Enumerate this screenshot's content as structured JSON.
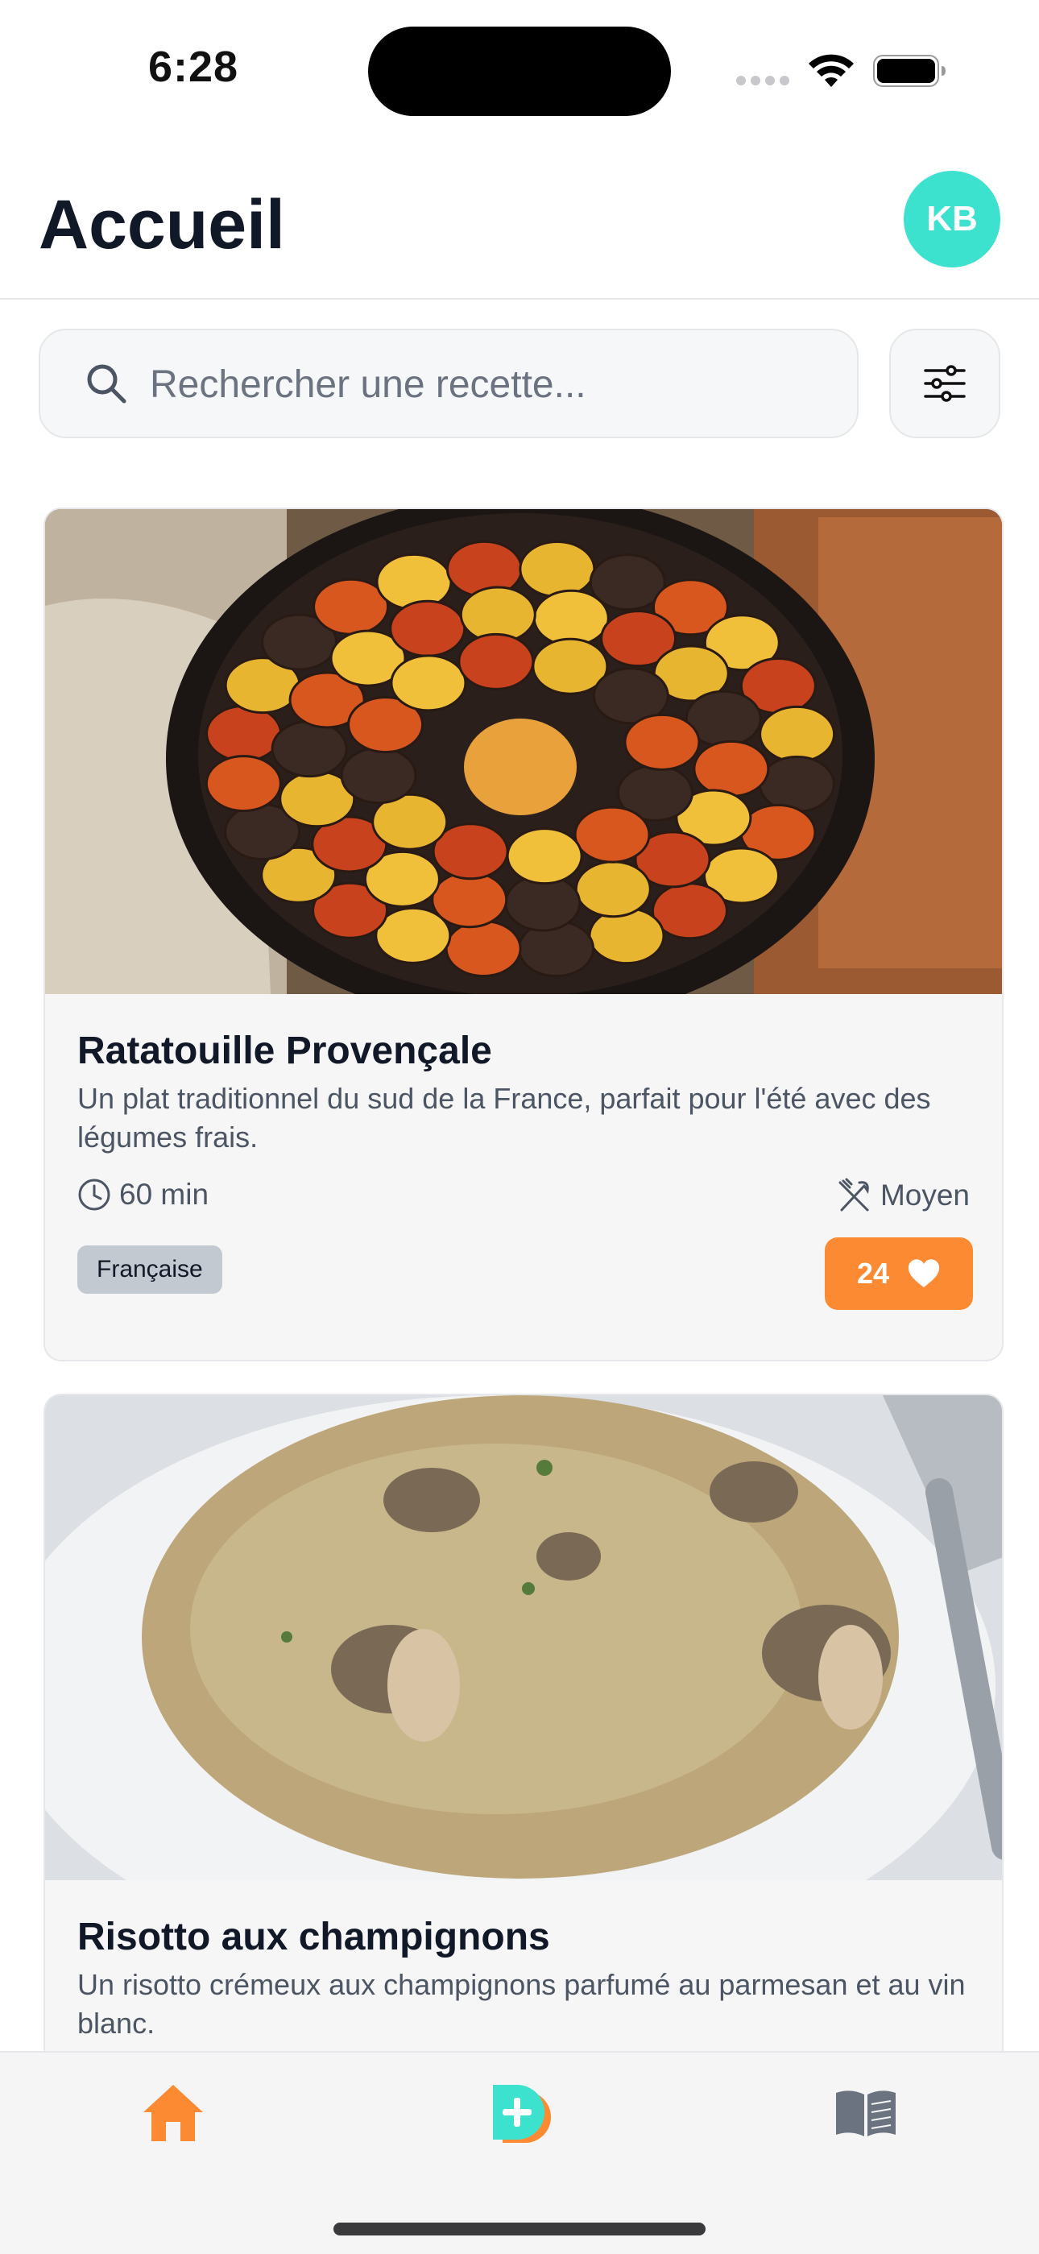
{
  "status_bar": {
    "time": "6:28"
  },
  "header": {
    "title": "Accueil",
    "avatar_initials": "KB"
  },
  "search": {
    "placeholder": "Rechercher une recette..."
  },
  "recipes": [
    {
      "title": "Ratatouille Provençale",
      "description": "Un plat traditionnel du sud de la France, parfait pour l'été avec des légumes frais.",
      "duration": "60 min",
      "difficulty": "Moyen",
      "tag": "Française",
      "likes": "24"
    },
    {
      "title": "Risotto aux champignons",
      "description": "Un risotto crémeux aux champignons parfumé au parmesan et au vin blanc."
    }
  ],
  "colors": {
    "accent_orange": "#fb8a32",
    "avatar_teal": "#3de2cf",
    "tag_grey": "#c3c9d1"
  },
  "tab_bar": {
    "items": [
      "home-icon",
      "add-recipe-icon",
      "book-icon"
    ],
    "active": "home-icon"
  }
}
